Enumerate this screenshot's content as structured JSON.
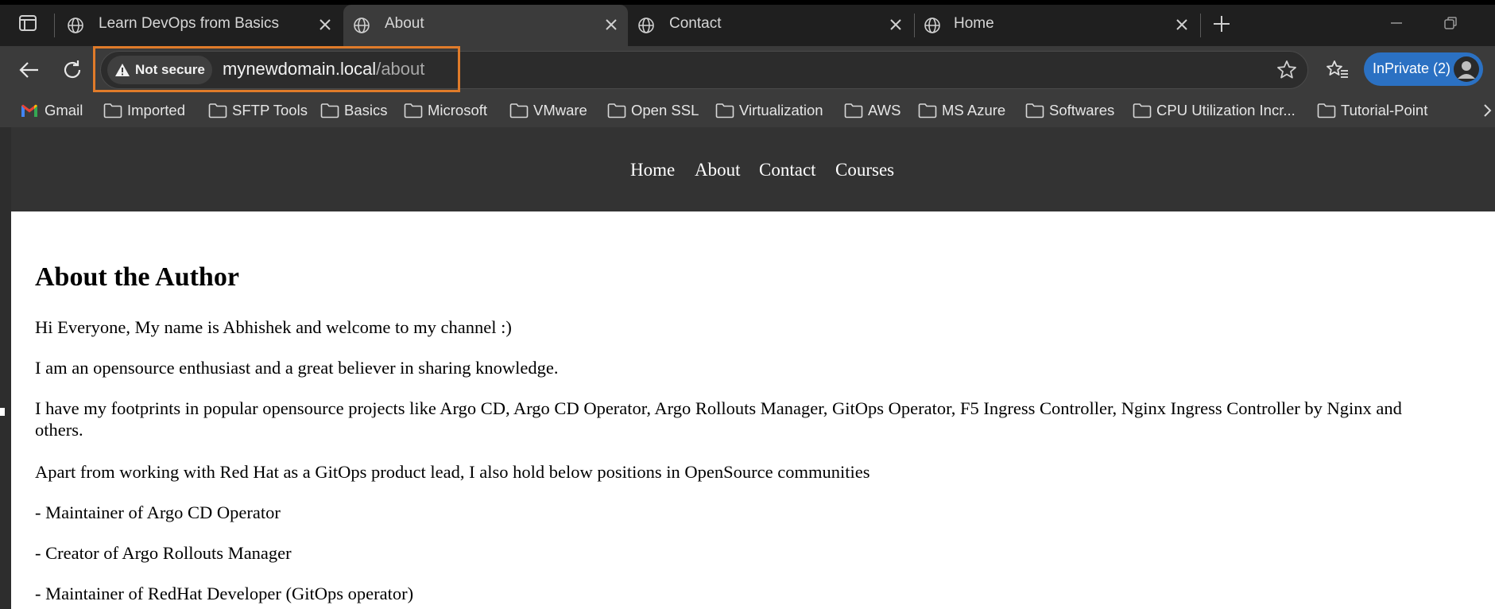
{
  "browser": {
    "tabs": [
      {
        "title": "Learn DevOps from Basics",
        "active": false
      },
      {
        "title": "About",
        "active": true
      },
      {
        "title": "Contact",
        "active": false
      },
      {
        "title": "Home",
        "active": false
      }
    ],
    "address_bar": {
      "security_label": "Not secure",
      "url_host": "mynewdomain.local",
      "url_path": "/about"
    },
    "profile_label": "InPrivate (2)",
    "bookmarks": [
      "Gmail",
      "Imported",
      "SFTP Tools",
      "Basics",
      "Microsoft",
      "VMware",
      "Open SSL",
      "Virtualization",
      "AWS",
      "MS Azure",
      "Softwares",
      "CPU Utilization Incr...",
      "Tutorial-Point"
    ],
    "colors": {
      "highlight_box": "#e07b2a",
      "inprivate_badge": "#2b71c3"
    }
  },
  "site": {
    "nav": [
      "Home",
      "About",
      "Contact",
      "Courses"
    ],
    "heading": "About the Author",
    "paragraphs": [
      "Hi Everyone, My name is Abhishek and welcome to my channel :)",
      "I am an opensource enthusiast and a great believer in sharing knowledge.",
      "I have my footprints in popular opensource projects like Argo CD, Argo CD Operator, Argo Rollouts Manager, GitOps Operator, F5 Ingress Controller, Nginx Ingress Controller by Nginx and",
      "others.",
      "Apart from working with Red Hat as a GitOps product lead, I also hold below positions in OpenSource communities",
      "- Maintainer of Argo CD Operator",
      "- Creator of Argo Rollouts Manager",
      "- Maintainer of RedHat Developer (GitOps operator)"
    ]
  }
}
